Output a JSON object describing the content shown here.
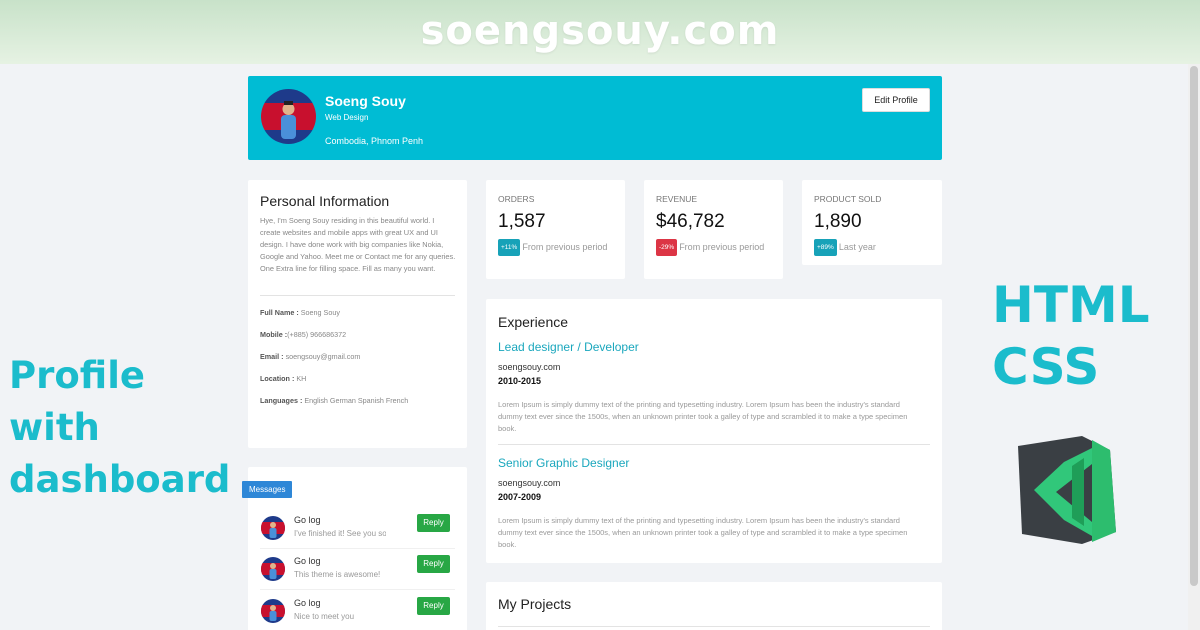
{
  "banner": {
    "title": "soengsouy.com"
  },
  "side_caption_left": {
    "line1": "Profile with",
    "line2": "dashboard"
  },
  "side_caption_right": {
    "line1": "HTML",
    "line2": "CSS"
  },
  "profile": {
    "name": "Soeng Souy",
    "role": "Web Design",
    "location": "Combodia, Phnom Penh",
    "edit_label": "Edit Profile",
    "accent_color": "#00bcd4"
  },
  "personal_info": {
    "title": "Personal Information",
    "about": "Hye, I'm Soeng Souy residing in this beautiful world. I create websites and mobile apps with great UX and UI design. I have done work with big companies like Nokia, Google and Yahoo. Meet me or Contact me for any queries. One Extra line for filling space. Fill as many you want.",
    "fields": [
      {
        "label": "Full Name :",
        "value": " Soeng Souy"
      },
      {
        "label": "Mobile :",
        "value": "(+885) 966686372"
      },
      {
        "label": "Email :",
        "value": " soengsouy@gmail.com"
      },
      {
        "label": "Location :",
        "value": " KH"
      },
      {
        "label": "Languages :",
        "value": " English German Spanish French"
      }
    ]
  },
  "messages": {
    "tag": "Messages",
    "items": [
      {
        "name": "Go log",
        "text": "I've finished it! See you so...",
        "reply": "Reply"
      },
      {
        "name": "Go log",
        "text": "This theme is awesome!",
        "reply": "Reply"
      },
      {
        "name": "Go log",
        "text": "Nice to meet you",
        "reply": "Reply"
      }
    ]
  },
  "stats": [
    {
      "label": "ORDERS",
      "value": "1,587",
      "badge": "+11%",
      "badge_color": "#17a2b8",
      "note": "From previous period"
    },
    {
      "label": "REVENUE",
      "value": "$46,782",
      "badge": "-29%",
      "badge_color": "#dc3545",
      "note": "From previous period"
    },
    {
      "label": "PRODUCT SOLD",
      "value": "1,890",
      "badge": "+89%",
      "badge_color": "#17a2b8",
      "note": "Last year"
    }
  ],
  "experience": {
    "title": "Experience",
    "jobs": [
      {
        "title": "Lead designer / Developer",
        "company": "soengsouy.com",
        "years": "2010-2015",
        "description": "Lorem Ipsum is simply dummy text of the printing and typesetting industry. Lorem Ipsum has been the industry's standard dummy text ever since the 1500s, when an unknown printer took a galley of type and scrambled it to make a type specimen book."
      },
      {
        "title": "Senior Graphic Designer",
        "company": "soengsouy.com",
        "years": "2007-2009",
        "description": "Lorem Ipsum is simply dummy text of the printing and typesetting industry. Lorem Ipsum has been the industry's standard dummy text ever since the 1500s, when an unknown printer took a galley of type and scrambled it to make a type specimen book."
      }
    ]
  },
  "projects": {
    "title": "My Projects"
  }
}
